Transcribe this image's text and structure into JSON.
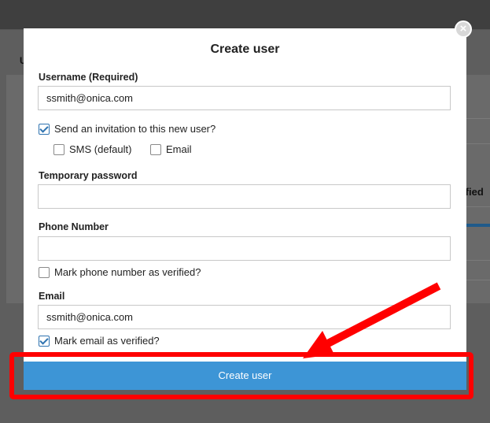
{
  "dialog": {
    "title": "Create user",
    "close_glyph": "×",
    "username": {
      "label": "Username (Required)",
      "value": "ssmith@onica.com"
    },
    "send_invitation": {
      "label": "Send an invitation to this new user?",
      "checked": true
    },
    "sms": {
      "label": "SMS (default)",
      "checked": false
    },
    "email_invite": {
      "label": "Email",
      "checked": false
    },
    "temp_password": {
      "label": "Temporary password",
      "value": ""
    },
    "phone": {
      "label": "Phone Number",
      "value": ""
    },
    "phone_verified": {
      "label": "Mark phone number as verified?",
      "checked": false
    },
    "email": {
      "label": "Email",
      "value": "ssmith@onica.com"
    },
    "email_verified": {
      "label": "Mark email as verified?",
      "checked": true
    },
    "submit_label": "Create user"
  },
  "background": {
    "letter": "U",
    "right_text": "rified"
  },
  "annotation": {
    "highlight_color": "#ff0000",
    "icon": "red-arrow-icon"
  },
  "colors": {
    "primary_button": "#3d95d6",
    "checkbox_accent": "#2f73b0"
  }
}
